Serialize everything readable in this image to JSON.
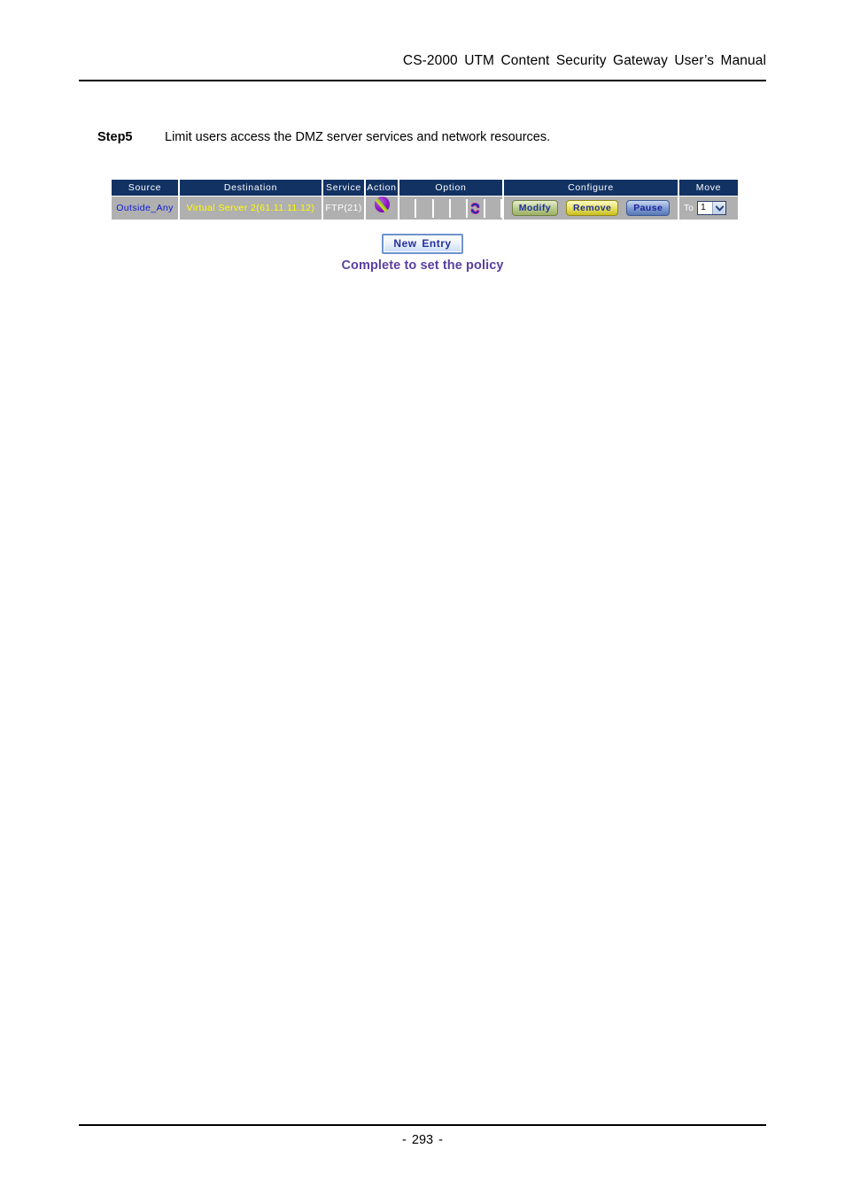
{
  "document": {
    "header_title": "CS-2000 UTM Content Security Gateway User’s Manual",
    "page_number": "- 293 -"
  },
  "step": {
    "label": "Step5",
    "text": "Limit users access the DMZ server services and network resources."
  },
  "policy_table": {
    "columns": [
      {
        "key": "source",
        "label": "Source"
      },
      {
        "key": "destination",
        "label": "Destination"
      },
      {
        "key": "service",
        "label": "Service"
      },
      {
        "key": "action",
        "label": "Action"
      },
      {
        "key": "option",
        "label": "Option"
      },
      {
        "key": "configure",
        "label": "Configure"
      },
      {
        "key": "move",
        "label": "Move"
      }
    ],
    "rows": [
      {
        "source": "Outside_Any",
        "destination": "Virtual Server 2(61.11.11.12)",
        "service": "FTP(21)",
        "action_icon": "permit-allow-icon",
        "option_icons": [
          "",
          "",
          "",
          "",
          "nat-loopback-icon",
          ""
        ],
        "configure": {
          "modify_label": "Modify",
          "remove_label": "Remove",
          "pause_label": "Pause"
        },
        "move": {
          "to_label": "To",
          "selected": "1",
          "options": [
            "1"
          ]
        }
      }
    ]
  },
  "new_entry_button": {
    "label": "New Entry"
  },
  "figure_caption": {
    "text": "Complete to set the policy"
  },
  "colors": {
    "header_bg": "#123264",
    "cell_bg": "#b0b0b0",
    "source_text": "#0b18d8",
    "destination_text": "#ffff00",
    "service_text": "#ffffff",
    "caption_text": "#5b3fa0",
    "new_entry_text": "#24309c",
    "modify_btn": "#b9c98c",
    "remove_btn": "#e8df5c",
    "pause_btn": "#7e9bd0"
  }
}
